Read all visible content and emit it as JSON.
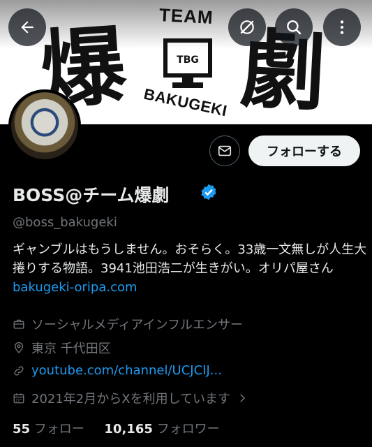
{
  "banner": {
    "kanji_left": "爆",
    "kanji_right": "劇",
    "team_text": "TEAM",
    "brand_text": "BAKUGEKI",
    "tv_text": "TBG"
  },
  "top_buttons": {
    "back": "back-arrow-icon",
    "grok": "grok-icon",
    "search": "search-icon",
    "more": "more-vertical-icon"
  },
  "profile": {
    "name": "BOSS@チーム爆劇",
    "handle": "@boss_bakugeki",
    "follow_label": "フォローする",
    "bio_text": "ギャンブルはもうしません。おそらく。33歳一文無しが人生大捲りする物語。3941池田浩二が生きがい。オリパ屋さん",
    "bio_link": "bakugeki-oripa.com",
    "category": "ソーシャルメディアインフルエンサー",
    "location": "東京 千代田区",
    "website": "youtube.com/channel/UCJCIJ...",
    "joined": "2021年2月からXを利用しています",
    "following_count": "55",
    "following_label": "フォロー",
    "followers_count": "10,165",
    "followers_label": "フォロワー"
  },
  "colors": {
    "accent": "#1d9bf0",
    "secondary_text": "#71767b",
    "primary_text": "#e7e9ea"
  }
}
